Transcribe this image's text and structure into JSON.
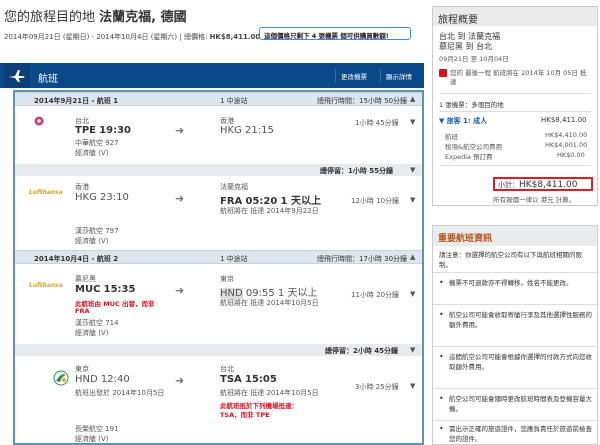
{
  "header": {
    "title_prefix": "您的旅程目的地",
    "title_dest": "法蘭克福, 德國",
    "dates": "2014年09月21日 (星期日) - 2014年10月4日 (星期六)",
    "total_label": "總價格:",
    "total_value": "HK$8,411.00",
    "notice": "這個價格只剩下 4 張機票 個可供購買數額!"
  },
  "flights": {
    "section_label": "航班",
    "change_button": "更改機票",
    "details_button": "顯示詳情",
    "outbound": {
      "date": "2014年9月21日 - 航班 1",
      "transfers": "1 中途站",
      "total_time": "總飛行時間：15小時 50分鐘",
      "leg1": {
        "from_city": "台北",
        "from_code": "TPE",
        "dep_time": "19:30",
        "airline": "中華航空 927",
        "cabin": "經濟艙 (V)",
        "to_city": "香港",
        "to_code": "HKG",
        "arr_time": "21:15",
        "duration": "1小時 45分鐘"
      },
      "stop": "總停留：1小時 55分鐘",
      "leg2": {
        "logo": "Lufthansa",
        "from_city": "香港",
        "from_code": "HKG",
        "dep_time": "23:10",
        "airline": "漢莎航空 797",
        "cabin": "經濟艙 (V)",
        "to_city": "法蘭克福",
        "to_code": "FRA",
        "arr_time": "05:20",
        "plus": "1 天以上",
        "arr_note": "航班將在 抵達 2014年9月22日",
        "duration": "12小時 10分鐘"
      }
    },
    "inbound": {
      "date": "2014年10月4日 - 航班 2",
      "transfers": "1 中途站",
      "total_time": "總飛行時間：17小時 30分鐘",
      "leg1": {
        "logo": "Lufthansa",
        "from_city": "慕尼黑",
        "from_code": "MUC",
        "dep_time": "15:35",
        "warn1": "此航班由 MUC 出發，而非",
        "warn2": "FRA",
        "airline": "漢莎航空 714",
        "cabin": "經濟艙 (V)",
        "to_city": "東京",
        "to_code": "HND",
        "arr_time": "09:55",
        "plus": "1 天以上",
        "arr_note": "航班將在 抵達 2014年10月5日",
        "duration": "11小時 20分鐘"
      },
      "stop": "總停留：2小時 45分鐘",
      "leg2": {
        "from_city": "東京",
        "from_code": "HND",
        "dep_time": "12:40",
        "dep_note": "航班出發於 2014年10月5日",
        "airline": "長榮航空 191",
        "cabin": "經濟艙 (V)",
        "to_city": "台北",
        "to_code": "TSA",
        "arr_time": "15:05",
        "arr_note": "航班將在 抵達 2014年10月5日",
        "warn1": "此航班抵於下列機場抵達：",
        "warn2": "TSA，而非 TPE",
        "duration": "3小時 25分鐘"
      }
    }
  },
  "summary": {
    "title": "旅程概要",
    "route1": "台北 到 法蘭克福",
    "route2": "慕尼黑 到 台北",
    "dates": "09月21日 至 10月04日",
    "notice": "您的 最後一程 航班將在 2014年 10月 05日 抵達",
    "tickets": "1 張機票：多個目的地",
    "traveler": "旅客 1: 成人",
    "traveler_price": "HK$8,411.00",
    "fare_label": "航班",
    "fare": "HK$4,410.00",
    "tax_label": "稅項&航空公司費用",
    "tax": "HK$4,001.00",
    "fee_label": "Expedia 預訂費",
    "fee": "HK$0.00",
    "subtotal_label": "小計：",
    "subtotal": "HK$8,411.00",
    "currency_note": "所有報價一律以 港元 計算。"
  },
  "info": {
    "title": "重要航班資訊",
    "intro": "請注意：你選擇的航空公司有以下與航班相關的限制。",
    "items": [
      "機票不可退款亦不得轉移。姓名不能更改。",
      "航空公司可能會收取寄艙行李及其他選擇性服務的額外費用。",
      "這間航空公司可能會根據你選擇的付款方式向您收取額外費用。",
      "航空公司可能會隨時更改航班時間表及登機容量大機。",
      "需出示正確的旅遊證件，您應負責任於旅遊前檢查您的證件。"
    ]
  },
  "colors": {
    "header_bar": "#0b4a8a",
    "accent_red": "#d8121d",
    "notice_border": "#3a8fd6",
    "info_title": "#b5541b"
  }
}
